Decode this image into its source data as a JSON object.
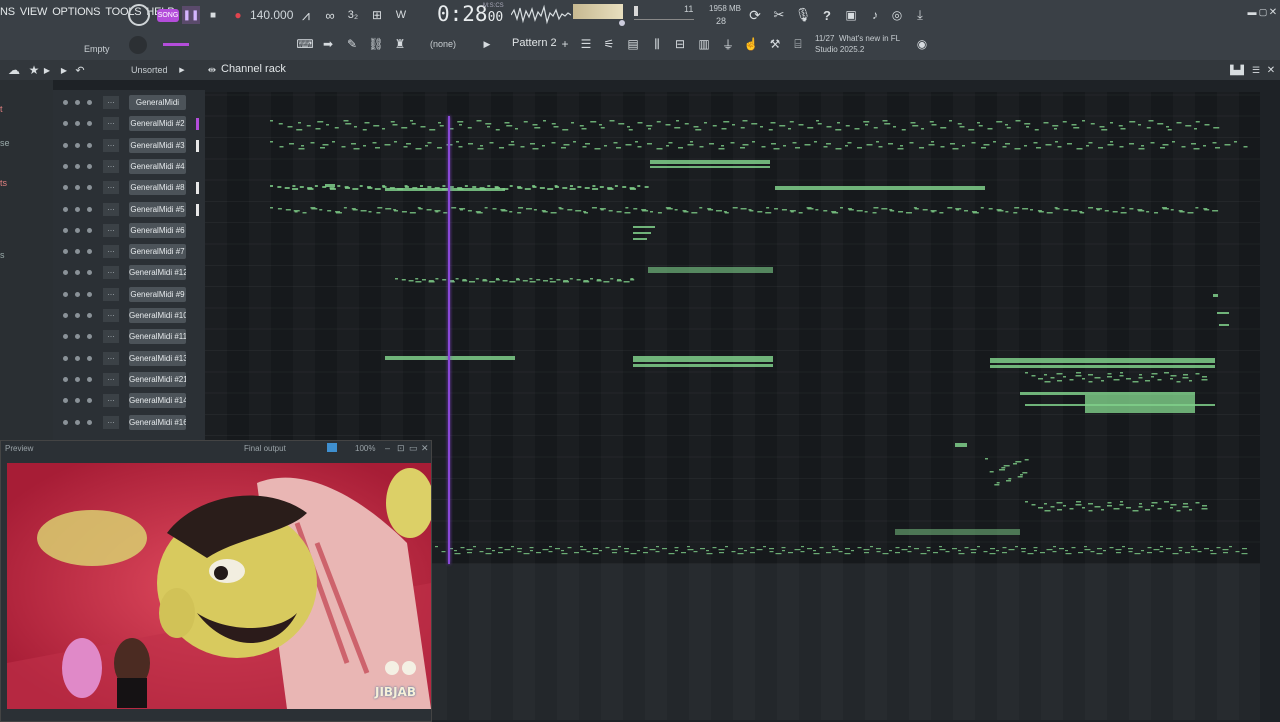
{
  "menu": [
    "NS",
    "VIEW",
    "OPTIONS",
    "TOOLS",
    "HELP"
  ],
  "transport": {
    "tempo": "140.000",
    "time": "0:28",
    "time_small": "00",
    "time_unit": "M:S:CS",
    "song_mode": "SONG"
  },
  "cpu": {
    "val1": "11",
    "mem": "1958 MB",
    "mem2": "28"
  },
  "top2": {
    "preset": "Empty",
    "snap": "(none)",
    "pattern": "Pattern 2",
    "news_count": "11/27",
    "news_text": "What's new in FL",
    "news_text2": "Studio 2025.2"
  },
  "channel_rack": {
    "title": "Channel rack",
    "filter": "Unsorted"
  },
  "channels": [
    {
      "name": "GeneralMidi",
      "mark": false
    },
    {
      "name": "GeneralMidi #2",
      "mark": true,
      "purple": true
    },
    {
      "name": "GeneralMidi #3",
      "mark": true
    },
    {
      "name": "GeneralMidi #4",
      "mark": false
    },
    {
      "name": "GeneralMidi #8",
      "mark": true
    },
    {
      "name": "GeneralMidi #5",
      "mark": true
    },
    {
      "name": "GeneralMidi #6",
      "mark": false
    },
    {
      "name": "GeneralMidi #7",
      "mark": false
    },
    {
      "name": "GeneralMidi #12",
      "mark": false
    },
    {
      "name": "GeneralMidi #9",
      "mark": false
    },
    {
      "name": "GeneralMidi #10",
      "mark": false
    },
    {
      "name": "GeneralMidi #11",
      "mark": false
    },
    {
      "name": "GeneralMidi #13",
      "mark": false
    },
    {
      "name": "GeneralMidi #21",
      "mark": false
    },
    {
      "name": "GeneralMidi #14",
      "mark": false
    },
    {
      "name": "GeneralMidi #16",
      "mark": false
    }
  ],
  "sidebar_labels": [
    "t",
    "se",
    "ts",
    "s"
  ],
  "preview": {
    "title": "Preview",
    "output": "Final output",
    "zoom": "100%",
    "logo": "JIBJAB"
  },
  "colors": {
    "note": "#7fcf8a",
    "playhead": "#8a49d8",
    "accent": "#b44ddb"
  }
}
